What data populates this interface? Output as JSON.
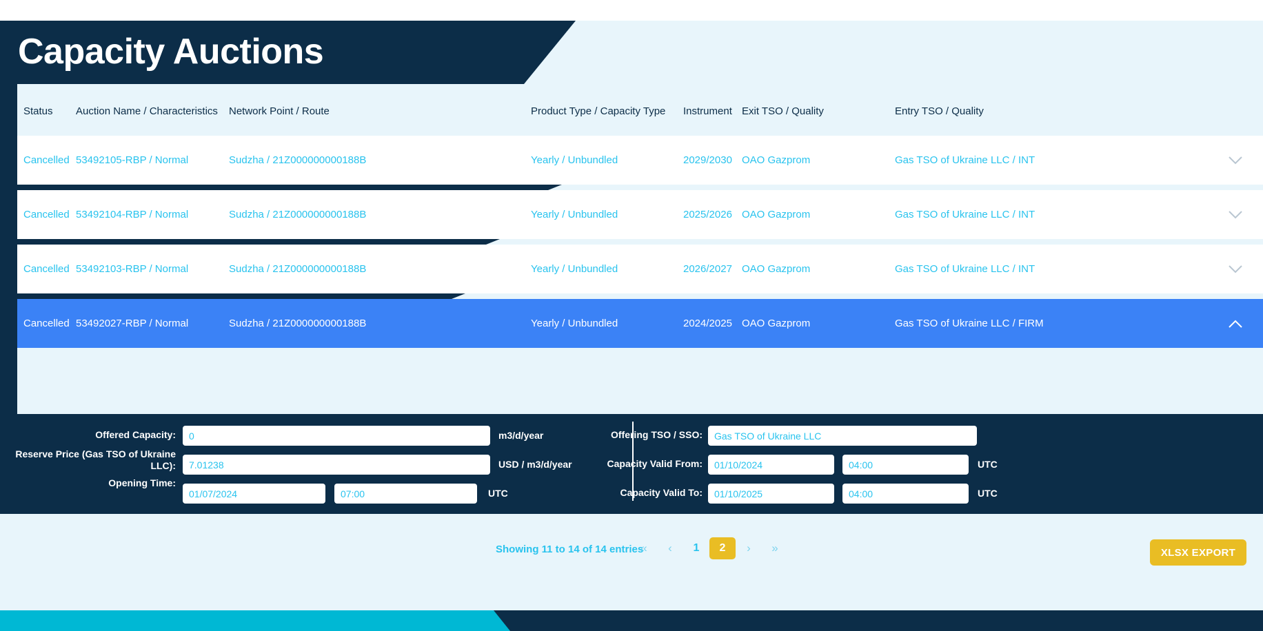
{
  "header": {
    "title": "Capacity Auctions"
  },
  "colors": {
    "navy": "#0c2d48",
    "page_bg": "#e8f5fb",
    "cyan_text": "#29c3ee",
    "selected_row": "#3b82f6",
    "accent_gold": "#e9bd24",
    "footer_cyan": "#00b8d4"
  },
  "table": {
    "columns": [
      "Status",
      "Auction Name / Characteristics",
      "Network Point / Route",
      "Product Type / Capacity Type",
      "Instrument",
      "Exit TSO / Quality",
      "Entry TSO / Quality"
    ],
    "rows": [
      {
        "status": "Cancelled",
        "auction_name": "53492105-RBP / Normal",
        "network_point": "Sudzha / 21Z000000000188B",
        "product_type": "Yearly / Unbundled",
        "instrument": "2029/2030",
        "exit_tso": "OAO Gazprom",
        "entry_tso": "Gas TSO of Ukraine LLC / INT",
        "expanded": false,
        "chevron": "chevron-down-icon"
      },
      {
        "status": "Cancelled",
        "auction_name": "53492104-RBP / Normal",
        "network_point": "Sudzha / 21Z000000000188B",
        "product_type": "Yearly / Unbundled",
        "instrument": "2025/2026",
        "exit_tso": "OAO Gazprom",
        "entry_tso": "Gas TSO of Ukraine LLC / INT",
        "expanded": false,
        "chevron": "chevron-down-icon"
      },
      {
        "status": "Cancelled",
        "auction_name": "53492103-RBP / Normal",
        "network_point": "Sudzha / 21Z000000000188B",
        "product_type": "Yearly / Unbundled",
        "instrument": "2026/2027",
        "exit_tso": "OAO Gazprom",
        "entry_tso": "Gas TSO of Ukraine LLC / INT",
        "expanded": false,
        "chevron": "chevron-down-icon"
      },
      {
        "status": "Cancelled",
        "auction_name": "53492027-RBP / Normal",
        "network_point": "Sudzha / 21Z000000000188B",
        "product_type": "Yearly / Unbundled",
        "instrument": "2024/2025",
        "exit_tso": "OAO Gazprom",
        "entry_tso": "Gas TSO of Ukraine LLC / FIRM",
        "expanded": true,
        "chevron": "chevron-up-icon"
      }
    ]
  },
  "detail": {
    "offered_capacity": {
      "label": "Offered Capacity:",
      "value": "0",
      "unit": "m3/d/year"
    },
    "reserve_price": {
      "label": "Reserve Price (Gas TSO of Ukraine LLC):",
      "value": "7.01238",
      "unit": "USD / m3/d/year"
    },
    "opening_time": {
      "label": "Opening Time:",
      "date": "01/07/2024",
      "time": "07:00",
      "unit": "UTC"
    },
    "offering_tso": {
      "label": "Offering TSO / SSO:",
      "value": "Gas TSO of Ukraine LLC"
    },
    "capacity_valid_from": {
      "label": "Capacity Valid From:",
      "date": "01/10/2024",
      "time": "04:00",
      "unit": "UTC"
    },
    "capacity_valid_to": {
      "label": "Capacity Valid To:",
      "date": "01/10/2025",
      "time": "04:00",
      "unit": "UTC"
    }
  },
  "footer": {
    "showing": "Showing 11 to 14 of 14 entries",
    "pagination": {
      "first": "«",
      "prev": "‹",
      "pages": [
        "1",
        "2"
      ],
      "active_page": "2",
      "next": "›",
      "last": "»"
    },
    "export_button": "XLSX EXPORT"
  }
}
